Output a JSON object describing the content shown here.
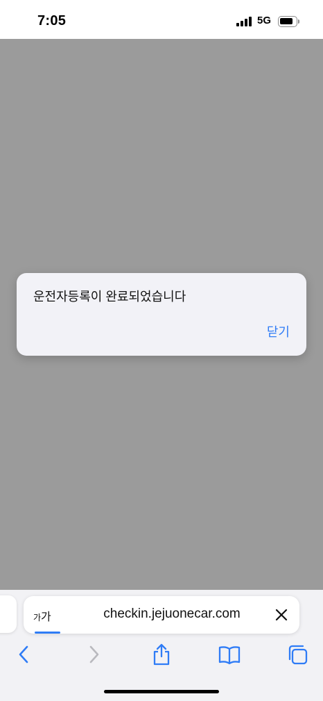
{
  "status_bar": {
    "time": "7:05",
    "network": "5G",
    "icons": [
      "signal-icon",
      "battery-icon"
    ]
  },
  "alert": {
    "message": "운전자등록이 완료되었습니다",
    "close_label": "닫기",
    "accent_color": "#2f7cf6"
  },
  "browser": {
    "reader_label_small": "가",
    "reader_label_large": "가",
    "url": "checkin.jejuonecar.com",
    "toolbar_icons": [
      "back-icon",
      "forward-icon",
      "share-icon",
      "bookmarks-icon",
      "tabs-icon"
    ]
  }
}
